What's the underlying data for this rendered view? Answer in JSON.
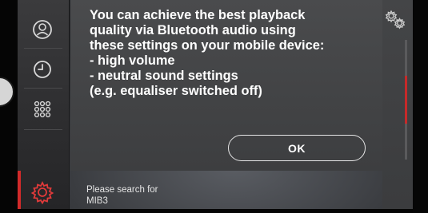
{
  "dialog": {
    "lines": [
      "You can achieve the best playback",
      "quality via Bluetooth audio using",
      "these settings on your mobile device:",
      "- high volume",
      "- neutral sound settings",
      "(e.g. equaliser switched off)"
    ],
    "ok_label": "OK"
  },
  "search_hint": {
    "line1": "Please search for",
    "line2": "MIB3"
  },
  "left_rail": {
    "icons": [
      "profile-icon",
      "clock-icon",
      "apps-grid-icon",
      "settings-gear-icon"
    ],
    "active": "settings-gear-icon"
  },
  "right_panel": {
    "icon": "gears-icon",
    "scroll_position": 0.35
  },
  "colors": {
    "accent": "#d22a2a",
    "dialog_bg": "#45464a",
    "text": "#ffffff"
  }
}
